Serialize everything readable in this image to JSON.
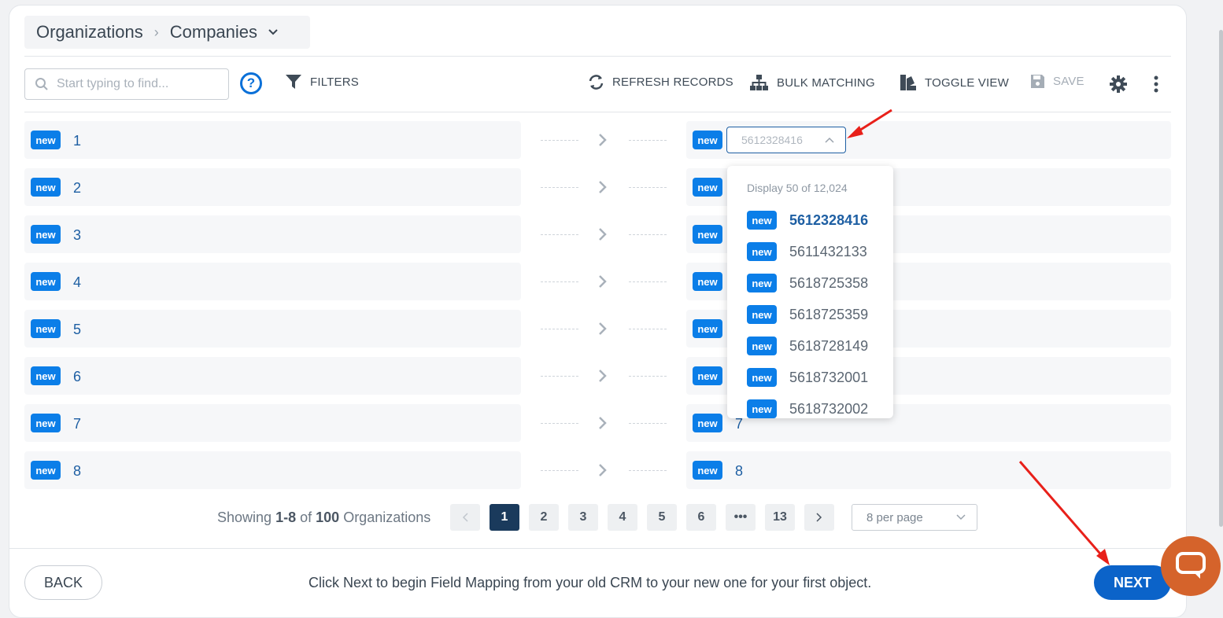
{
  "breadcrumb": {
    "root": "Organizations",
    "current": "Companies"
  },
  "search": {
    "placeholder": "Start typing to find..."
  },
  "toolbar": {
    "help": "?",
    "filters": "FILTERS",
    "refresh": "REFRESH RECORDS",
    "bulk": "BULK MATCHING",
    "toggle": "TOGGLE VIEW",
    "save": "SAVE"
  },
  "badge_label": "new",
  "rows": [
    {
      "left": "1",
      "right": ""
    },
    {
      "left": "2",
      "right": ""
    },
    {
      "left": "3",
      "right": ""
    },
    {
      "left": "4",
      "right": ""
    },
    {
      "left": "5",
      "right": ""
    },
    {
      "left": "6",
      "right": ""
    },
    {
      "left": "7",
      "right": "7"
    },
    {
      "left": "8",
      "right": "8"
    }
  ],
  "select": {
    "value": "5612328416"
  },
  "dropdown": {
    "header": "Display 50 of 12,024",
    "items": [
      "5612328416",
      "5611432133",
      "5618725358",
      "5618725359",
      "5618728149",
      "5618732001",
      "5618732002"
    ]
  },
  "pagination": {
    "showing_prefix": "Showing",
    "range": "1-8",
    "of": "of",
    "total": "100",
    "unit": "Organizations",
    "pages": [
      "1",
      "2",
      "3",
      "4",
      "5",
      "6",
      "•••",
      "13"
    ],
    "active_page": "1",
    "per_page": "8 per page"
  },
  "footer": {
    "back": "BACK",
    "note": "Click Next to begin Field Mapping from your old CRM to your new one for your first object.",
    "next": "NEXT"
  },
  "colors": {
    "accent": "#0b7ee8",
    "link": "#1e5fa3",
    "active_page": "#1a3a5c",
    "chat": "#d5632b",
    "annotation": "#e8201a"
  }
}
